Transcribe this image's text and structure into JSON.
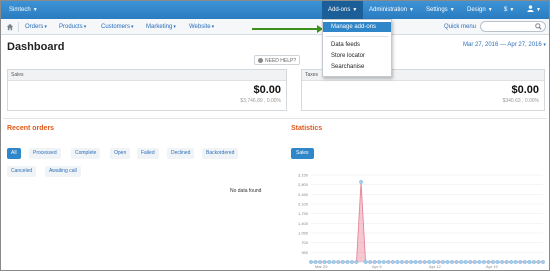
{
  "topbar": {
    "store_name": "Simtech",
    "menus": [
      "Add-ons",
      "Administration",
      "Settings",
      "Design",
      "$"
    ]
  },
  "addons_dropdown": {
    "items": [
      "Manage add-ons",
      "Data feeds",
      "Store locator",
      "Searchanise"
    ],
    "highlighted": "Manage add-ons"
  },
  "menubar": {
    "items": [
      "Orders",
      "Products",
      "Customers",
      "Marketing",
      "Website"
    ],
    "quick_menu": "Quick menu"
  },
  "page": {
    "title": "Dashboard",
    "need_help": "NEED HELP?",
    "date_range": "Mar 27, 2016 — Apr 27, 2016"
  },
  "cards": {
    "sales": {
      "label": "Sales",
      "value": "$0.00",
      "sub": "$3,746.89 , 0.00%"
    },
    "taxes": {
      "label": "Taxes",
      "value": "$0.00",
      "sub": "$340.63 , 0.00%"
    }
  },
  "recent_orders": {
    "title": "Recent orders",
    "tabs": [
      "All",
      "Processed",
      "Complete",
      "Open",
      "Failed",
      "Declined",
      "Backordered",
      "Canceled",
      "Awaiting call"
    ],
    "selected_tab": "All",
    "empty_text": "No data found"
  },
  "statistics": {
    "title": "Statistics",
    "tab": "Sales"
  },
  "colors": {
    "topbar": "#2b7cc0",
    "accent": "#2f86c9",
    "section_title": "#e05a1c",
    "arrow": "#3d8f1b",
    "chart_line": "#e9849a"
  },
  "chart_data": {
    "type": "area",
    "title": "",
    "xlabel": "",
    "ylabel": "",
    "yticks": [
      "3,150",
      "2,800",
      "2,450",
      "2,100",
      "1,750",
      "1,400",
      "1,050",
      "700",
      "350"
    ],
    "xticks": [
      "Mar 29",
      "Apr 5",
      "Apr 12",
      "Apr 19"
    ],
    "ylim": [
      0,
      3150
    ],
    "series": [
      {
        "values": [
          0,
          0,
          0,
          0,
          0,
          0,
          0,
          0,
          0,
          0,
          0,
          2900,
          0,
          0,
          0,
          0,
          0,
          0,
          0,
          0,
          0,
          0,
          0,
          0,
          0,
          0,
          0,
          0,
          0,
          0,
          0,
          0,
          0,
          0,
          0,
          0,
          0,
          0,
          0,
          0,
          0,
          0,
          0,
          0,
          0,
          0,
          0,
          0,
          0,
          0,
          0,
          0
        ]
      }
    ]
  }
}
